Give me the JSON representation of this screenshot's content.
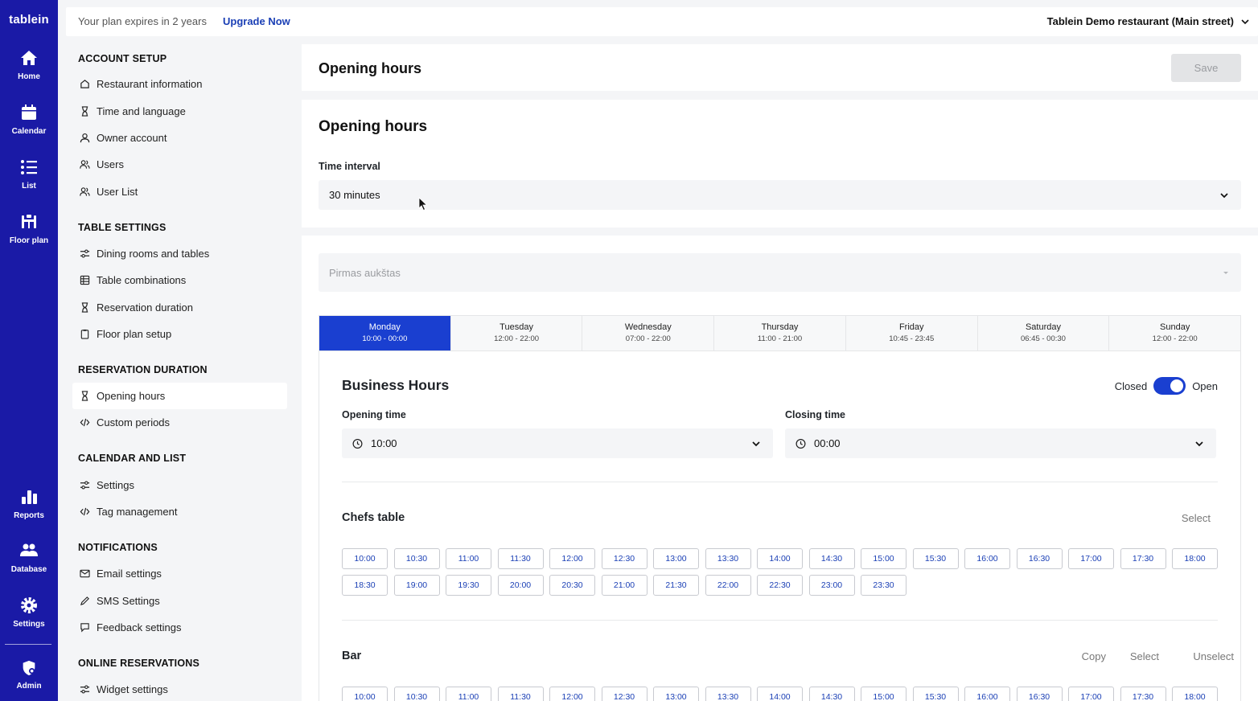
{
  "brand": {
    "logo": "tablein"
  },
  "rail": [
    {
      "label": "Home",
      "icon": "home-icon"
    },
    {
      "label": "Calendar",
      "icon": "calendar-icon"
    },
    {
      "label": "List",
      "icon": "list-icon"
    },
    {
      "label": "Floor plan",
      "icon": "floor-plan-icon"
    },
    {
      "label": "Reports",
      "icon": "reports-icon"
    },
    {
      "label": "Database",
      "icon": "database-icon"
    },
    {
      "label": "Settings",
      "icon": "gear-icon"
    },
    {
      "label": "Admin",
      "icon": "admin-shield-icon"
    }
  ],
  "topbar": {
    "plan_text": "Your plan expires in 2 years",
    "upgrade_label": "Upgrade Now",
    "restaurant": "Tablein Demo restaurant (Main street)"
  },
  "sidebar": {
    "sections": [
      {
        "title": "ACCOUNT SETUP",
        "items": [
          {
            "label": "Restaurant information",
            "icon": "home-icon"
          },
          {
            "label": "Time and language",
            "icon": "hourglass-icon"
          },
          {
            "label": "Owner account",
            "icon": "user-icon"
          },
          {
            "label": "Users",
            "icon": "users-icon"
          },
          {
            "label": "User List",
            "icon": "users-icon"
          }
        ]
      },
      {
        "title": "TABLE SETTINGS",
        "items": [
          {
            "label": "Dining rooms and tables",
            "icon": "sliders-icon"
          },
          {
            "label": "Table combinations",
            "icon": "grid-icon"
          },
          {
            "label": "Reservation duration",
            "icon": "hourglass-icon"
          },
          {
            "label": "Floor plan setup",
            "icon": "clipboard-icon"
          }
        ]
      },
      {
        "title": "RESERVATION DURATION",
        "items": [
          {
            "label": "Opening hours",
            "icon": "hourglass-icon",
            "active": true
          },
          {
            "label": "Custom periods",
            "icon": "code-icon"
          }
        ]
      },
      {
        "title": "CALENDAR AND LIST",
        "items": [
          {
            "label": "Settings",
            "icon": "sliders-icon"
          },
          {
            "label": "Tag management",
            "icon": "code-icon"
          }
        ]
      },
      {
        "title": "NOTIFICATIONS",
        "items": [
          {
            "label": "Email settings",
            "icon": "mail-icon"
          },
          {
            "label": "SMS Settings",
            "icon": "pen-icon"
          },
          {
            "label": "Feedback settings",
            "icon": "feedback-icon"
          }
        ]
      },
      {
        "title": "ONLINE RESERVATIONS",
        "items": [
          {
            "label": "Widget settings",
            "icon": "sliders-icon"
          }
        ]
      }
    ]
  },
  "header": {
    "title": "Opening hours",
    "save_label": "Save"
  },
  "interval": {
    "title": "Opening hours",
    "label": "Time interval",
    "value": "30 minutes"
  },
  "floor": {
    "placeholder": "Pirmas aukštas"
  },
  "days": [
    {
      "name": "Monday",
      "hours": "10:00 - 00:00",
      "active": true
    },
    {
      "name": "Tuesday",
      "hours": "12:00 - 22:00"
    },
    {
      "name": "Wednesday",
      "hours": "07:00 - 22:00"
    },
    {
      "name": "Thursday",
      "hours": "11:00 - 21:00"
    },
    {
      "name": "Friday",
      "hours": "10:45 - 23:45"
    },
    {
      "name": "Saturday",
      "hours": "06:45 - 00:30"
    },
    {
      "name": "Sunday",
      "hours": "12:00 - 22:00"
    }
  ],
  "business": {
    "title": "Business Hours",
    "closed_label": "Closed",
    "open_label": "Open",
    "opening_label": "Opening time",
    "opening_value": "10:00",
    "closing_label": "Closing time",
    "closing_value": "00:00"
  },
  "areas": [
    {
      "name": "Chefs table",
      "actions": [
        "Select"
      ],
      "slots": [
        "10:00",
        "10:30",
        "11:00",
        "11:30",
        "12:00",
        "12:30",
        "13:00",
        "13:30",
        "14:00",
        "14:30",
        "15:00",
        "15:30",
        "16:00",
        "16:30",
        "17:00",
        "17:30",
        "18:00",
        "18:30",
        "19:00",
        "19:30",
        "20:00",
        "20:30",
        "21:00",
        "21:30",
        "22:00",
        "22:30",
        "23:00",
        "23:30"
      ]
    },
    {
      "name": "Bar",
      "actions": [
        "Copy",
        "Select",
        "Unselect"
      ],
      "slots": [
        "10:00",
        "10:30",
        "11:00",
        "11:30",
        "12:00",
        "12:30",
        "13:00",
        "13:30",
        "14:00",
        "14:30",
        "15:00",
        "15:30",
        "16:00",
        "16:30",
        "17:00",
        "17:30",
        "18:00"
      ]
    }
  ],
  "colors": {
    "rail": "#1a1aa6",
    "accent": "#1a3fd0",
    "link": "#1a3fb5",
    "logo_dot": "#f5a623"
  }
}
